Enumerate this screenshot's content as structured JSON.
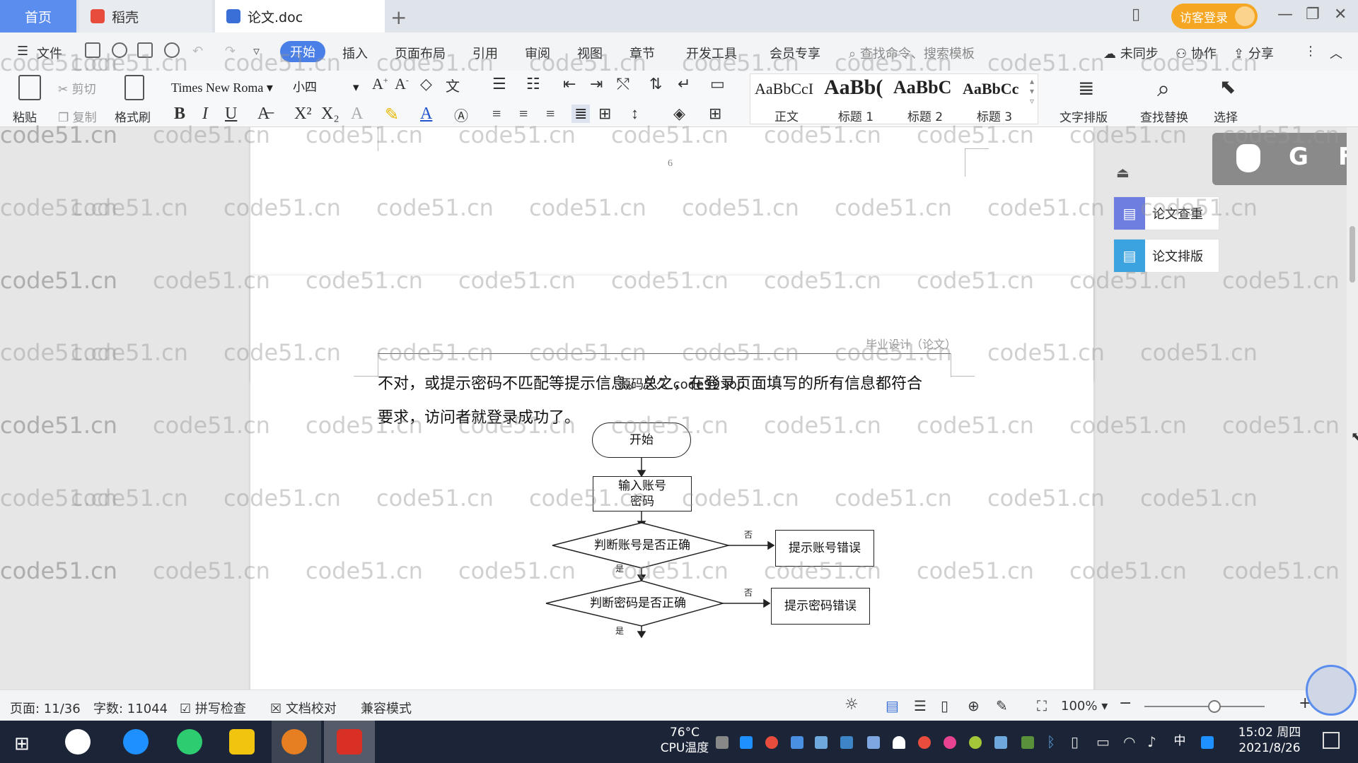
{
  "tabs": {
    "home": "首页",
    "docer": "稻壳",
    "doc": "论文.doc",
    "add": "+"
  },
  "titlebar": {
    "login": "访客登录"
  },
  "menu": {
    "file": "文件",
    "items": [
      "开始",
      "插入",
      "页面布局",
      "引用",
      "审阅",
      "视图",
      "章节",
      "开发工具",
      "会员专享"
    ],
    "search_placeholder": "查找命令、搜索模板",
    "sync": "未同步",
    "collab": "协作",
    "share": "分享"
  },
  "ribbon": {
    "paste": "粘贴",
    "cut": "剪切",
    "copy": "复制",
    "format_painter": "格式刷",
    "font_name": "Times New Roma",
    "font_size": "小四",
    "bold": "B",
    "italic": "I",
    "underline": "U",
    "styles": [
      {
        "preview": "AaBbCcI",
        "name": "正文"
      },
      {
        "preview": "AaBb(",
        "name": "标题 1"
      },
      {
        "preview": "AaBbC",
        "name": "标题 2"
      },
      {
        "preview": "AaBbCc",
        "name": "标题 3"
      }
    ],
    "text_layout": "文字排版",
    "find_replace": "查找替换",
    "select": "选择"
  },
  "document": {
    "page_number": "6",
    "header": "毕业设计（论文）",
    "paragraph_line1": "不对，或提示密码不匹配等提示信息。总之，在登录页面填写的所有信息都符合",
    "paragraph_line2": "要求，访问者就登录成功了。",
    "overlay_text": "源码久久 code99.top",
    "flowchart": {
      "start": "开始",
      "input": "输入账号密码",
      "check_account": "判断账号是否正确",
      "account_error": "提示账号错误",
      "check_password": "判断密码是否正确",
      "password_error": "提示密码错误",
      "no": "否",
      "yes": "是"
    }
  },
  "sidebar": {
    "paper_check": "论文查重",
    "paper_layout": "论文排版"
  },
  "floating": {
    "g": "G",
    "f": "F"
  },
  "watermark": "code51.cn",
  "status": {
    "page": "页面: 11/36",
    "words": "字数: 11044",
    "spell": "拼写检查",
    "proof": "文档校对",
    "compat": "兼容模式",
    "zoom": "100%"
  },
  "taskbar": {
    "temp": "76°C",
    "cpu": "CPU温度",
    "ime": "中",
    "time": "15:02 周四",
    "date": "2021/8/26"
  },
  "colors": {
    "accent": "#4a7fe8",
    "login": "#f5a623",
    "taskbar": "#1c2538"
  }
}
